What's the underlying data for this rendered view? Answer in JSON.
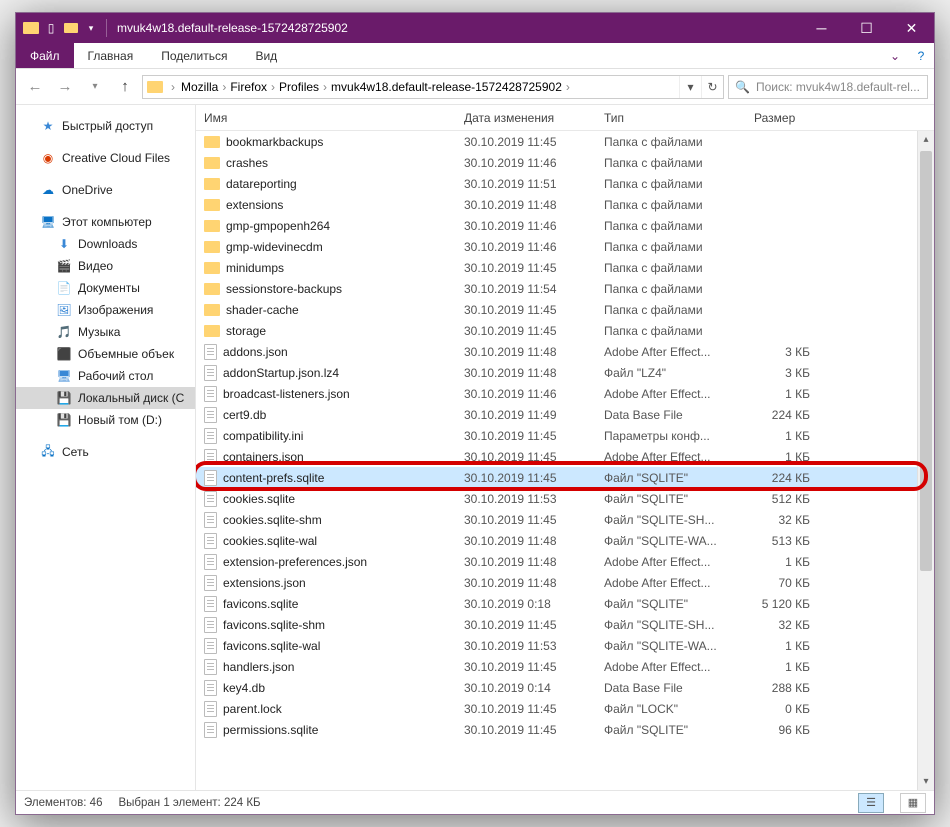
{
  "window": {
    "title": "mvuk4w18.default-release-1572428725902"
  },
  "ribbon": {
    "file": "Файл",
    "tabs": [
      "Главная",
      "Поделиться",
      "Вид"
    ]
  },
  "breadcrumbs": [
    "Mozilla",
    "Firefox",
    "Profiles",
    "mvuk4w18.default-release-1572428725902"
  ],
  "search": {
    "placeholder": "Поиск: mvuk4w18.default-rel..."
  },
  "columns": {
    "name": "Имя",
    "date": "Дата изменения",
    "type": "Тип",
    "size": "Размер"
  },
  "sidebar": {
    "quick": "Быстрый доступ",
    "creative": "Creative Cloud Files",
    "onedrive": "OneDrive",
    "thispc": "Этот компьютер",
    "pc": [
      "Downloads",
      "Видео",
      "Документы",
      "Изображения",
      "Музыка",
      "Объемные объек",
      "Рабочий стол",
      "Локальный диск (C",
      "Новый том (D:)"
    ],
    "network": "Сеть"
  },
  "files": [
    {
      "icon": "folder",
      "name": "bookmarkbackups",
      "date": "30.10.2019 11:45",
      "type": "Папка с файлами",
      "size": ""
    },
    {
      "icon": "folder",
      "name": "crashes",
      "date": "30.10.2019 11:46",
      "type": "Папка с файлами",
      "size": ""
    },
    {
      "icon": "folder",
      "name": "datareporting",
      "date": "30.10.2019 11:51",
      "type": "Папка с файлами",
      "size": ""
    },
    {
      "icon": "folder",
      "name": "extensions",
      "date": "30.10.2019 11:48",
      "type": "Папка с файлами",
      "size": ""
    },
    {
      "icon": "folder",
      "name": "gmp-gmpopenh264",
      "date": "30.10.2019 11:46",
      "type": "Папка с файлами",
      "size": ""
    },
    {
      "icon": "folder",
      "name": "gmp-widevinecdm",
      "date": "30.10.2019 11:46",
      "type": "Папка с файлами",
      "size": ""
    },
    {
      "icon": "folder",
      "name": "minidumps",
      "date": "30.10.2019 11:45",
      "type": "Папка с файлами",
      "size": ""
    },
    {
      "icon": "folder",
      "name": "sessionstore-backups",
      "date": "30.10.2019 11:54",
      "type": "Папка с файлами",
      "size": ""
    },
    {
      "icon": "folder",
      "name": "shader-cache",
      "date": "30.10.2019 11:45",
      "type": "Папка с файлами",
      "size": ""
    },
    {
      "icon": "folder",
      "name": "storage",
      "date": "30.10.2019 11:45",
      "type": "Папка с файлами",
      "size": ""
    },
    {
      "icon": "file",
      "name": "addons.json",
      "date": "30.10.2019 11:48",
      "type": "Adobe After Effect...",
      "size": "3 КБ"
    },
    {
      "icon": "file",
      "name": "addonStartup.json.lz4",
      "date": "30.10.2019 11:48",
      "type": "Файл \"LZ4\"",
      "size": "3 КБ"
    },
    {
      "icon": "file",
      "name": "broadcast-listeners.json",
      "date": "30.10.2019 11:46",
      "type": "Adobe After Effect...",
      "size": "1 КБ"
    },
    {
      "icon": "file",
      "name": "cert9.db",
      "date": "30.10.2019 11:49",
      "type": "Data Base File",
      "size": "224 КБ"
    },
    {
      "icon": "file",
      "name": "compatibility.ini",
      "date": "30.10.2019 11:45",
      "type": "Параметры конф...",
      "size": "1 КБ"
    },
    {
      "icon": "file",
      "name": "containers.json",
      "date": "30.10.2019 11:45",
      "type": "Adobe After Effect...",
      "size": "1 КБ"
    },
    {
      "icon": "file",
      "name": "content-prefs.sqlite",
      "date": "30.10.2019 11:45",
      "type": "Файл \"SQLITE\"",
      "size": "224 КБ",
      "selected": true,
      "highlight": true
    },
    {
      "icon": "file",
      "name": "cookies.sqlite",
      "date": "30.10.2019 11:53",
      "type": "Файл \"SQLITE\"",
      "size": "512 КБ"
    },
    {
      "icon": "file",
      "name": "cookies.sqlite-shm",
      "date": "30.10.2019 11:45",
      "type": "Файл \"SQLITE-SH...",
      "size": "32 КБ"
    },
    {
      "icon": "file",
      "name": "cookies.sqlite-wal",
      "date": "30.10.2019 11:48",
      "type": "Файл \"SQLITE-WA...",
      "size": "513 КБ"
    },
    {
      "icon": "file",
      "name": "extension-preferences.json",
      "date": "30.10.2019 11:48",
      "type": "Adobe After Effect...",
      "size": "1 КБ"
    },
    {
      "icon": "file",
      "name": "extensions.json",
      "date": "30.10.2019 11:48",
      "type": "Adobe After Effect...",
      "size": "70 КБ"
    },
    {
      "icon": "file",
      "name": "favicons.sqlite",
      "date": "30.10.2019 0:18",
      "type": "Файл \"SQLITE\"",
      "size": "5 120 КБ"
    },
    {
      "icon": "file",
      "name": "favicons.sqlite-shm",
      "date": "30.10.2019 11:45",
      "type": "Файл \"SQLITE-SH...",
      "size": "32 КБ"
    },
    {
      "icon": "file",
      "name": "favicons.sqlite-wal",
      "date": "30.10.2019 11:53",
      "type": "Файл \"SQLITE-WA...",
      "size": "1 КБ"
    },
    {
      "icon": "file",
      "name": "handlers.json",
      "date": "30.10.2019 11:45",
      "type": "Adobe After Effect...",
      "size": "1 КБ"
    },
    {
      "icon": "file",
      "name": "key4.db",
      "date": "30.10.2019 0:14",
      "type": "Data Base File",
      "size": "288 КБ"
    },
    {
      "icon": "file",
      "name": "parent.lock",
      "date": "30.10.2019 11:45",
      "type": "Файл \"LOCK\"",
      "size": "0 КБ"
    },
    {
      "icon": "file",
      "name": "permissions.sqlite",
      "date": "30.10.2019 11:45",
      "type": "Файл \"SQLITE\"",
      "size": "96 КБ"
    }
  ],
  "status": {
    "elements": "Элементов: 46",
    "selected": "Выбран 1 элемент: 224 КБ"
  }
}
